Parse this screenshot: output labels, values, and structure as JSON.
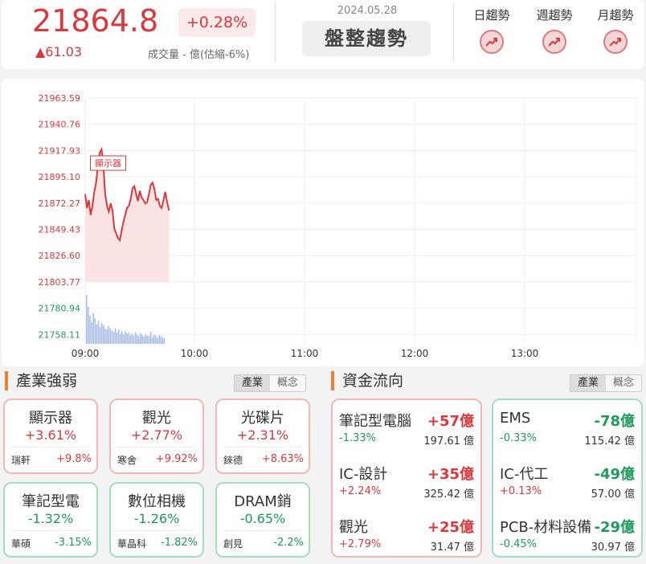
{
  "header": {
    "price": "21864.8",
    "pct": "+0.28%",
    "change": "▲61.03",
    "volume": "成交量 - 億(估縮-6%)",
    "date": "2024.05.28",
    "trend": "盤整趨勢",
    "trend_items": [
      "日趨勢",
      "週趨勢",
      "月趨勢"
    ]
  },
  "chart_data": {
    "type": "line",
    "x_ticks": [
      "09:00",
      "10:00",
      "11:00",
      "12:00",
      "13:00"
    ],
    "y_ticks": [
      "21963.59",
      "21940.76",
      "21917.93",
      "21895.10",
      "21872.27",
      "21849.43",
      "21826.60",
      "21803.77",
      "21780.94",
      "21758.11"
    ],
    "ylim": [
      21745,
      21970
    ],
    "xlim": [
      0,
      300
    ],
    "annotation": {
      "x": 2,
      "text": "顯示器"
    },
    "price": [
      [
        0,
        21880
      ],
      [
        1,
        21868
      ],
      [
        2,
        21875
      ],
      [
        3,
        21862
      ],
      [
        4,
        21870
      ],
      [
        5,
        21882
      ],
      [
        6,
        21890
      ],
      [
        7,
        21905
      ],
      [
        8,
        21916
      ],
      [
        9,
        21919
      ],
      [
        10,
        21905
      ],
      [
        11,
        21880
      ],
      [
        12,
        21870
      ],
      [
        13,
        21865
      ],
      [
        14,
        21872
      ],
      [
        15,
        21866
      ],
      [
        16,
        21850
      ],
      [
        17,
        21846
      ],
      [
        18,
        21842
      ],
      [
        19,
        21840
      ],
      [
        20,
        21848
      ],
      [
        21,
        21856
      ],
      [
        22,
        21862
      ],
      [
        23,
        21868
      ],
      [
        24,
        21870
      ],
      [
        25,
        21876
      ],
      [
        26,
        21885
      ],
      [
        27,
        21887
      ],
      [
        28,
        21880
      ],
      [
        29,
        21874
      ],
      [
        30,
        21883
      ],
      [
        31,
        21877
      ],
      [
        32,
        21875
      ],
      [
        33,
        21872
      ],
      [
        34,
        21873
      ],
      [
        35,
        21880
      ],
      [
        36,
        21888
      ],
      [
        37,
        21890
      ],
      [
        38,
        21885
      ],
      [
        39,
        21875
      ],
      [
        40,
        21876
      ],
      [
        41,
        21870
      ],
      [
        42,
        21868
      ],
      [
        43,
        21875
      ],
      [
        44,
        21882
      ],
      [
        45,
        21873
      ],
      [
        46,
        21866
      ]
    ],
    "volume_bars": [
      0.95,
      0.72,
      0.55,
      0.42,
      0.6,
      0.5,
      0.38,
      0.45,
      0.33,
      0.4,
      0.36,
      0.3,
      0.28,
      0.35,
      0.3,
      0.26,
      0.24,
      0.3,
      0.22,
      0.28,
      0.2,
      0.25,
      0.18,
      0.24,
      0.2,
      0.22,
      0.17,
      0.2,
      0.16,
      0.23,
      0.18,
      0.15,
      0.21,
      0.17,
      0.14,
      0.19,
      0.16,
      0.15,
      0.24,
      0.13,
      0.18,
      0.16,
      0.12,
      0.17,
      0.15,
      0.13,
      0.11
    ]
  },
  "sections": {
    "industry_title": "產業強弱",
    "flow_title": "資金流向",
    "seg_a": "產業",
    "seg_b": "概念"
  },
  "cards": [
    {
      "name": "顯示器",
      "pct": "+3.61%",
      "stock": "瑞軒",
      "stock_pct": "+9.8%",
      "dir": "up"
    },
    {
      "name": "觀光",
      "pct": "+2.77%",
      "stock": "寒舍",
      "stock_pct": "+9.92%",
      "dir": "up"
    },
    {
      "name": "光碟片",
      "pct": "+2.31%",
      "stock": "錸德",
      "stock_pct": "+8.63%",
      "dir": "up"
    },
    {
      "name": "筆記型電",
      "pct": "-1.32%",
      "stock": "華碩",
      "stock_pct": "-3.15%",
      "dir": "dn"
    },
    {
      "name": "數位相機",
      "pct": "-1.26%",
      "stock": "華晶科",
      "stock_pct": "-1.82%",
      "dir": "dn"
    },
    {
      "name": "DRAM銷",
      "pct": "-0.65%",
      "stock": "創見",
      "stock_pct": "-2.2%",
      "dir": "dn"
    }
  ],
  "flows_up": [
    {
      "name": "筆記型電腦",
      "amount": "+57億",
      "pct": "-1.33%",
      "value": "197.61 億",
      "pdir": "dn"
    },
    {
      "name": "IC-設計",
      "amount": "+35億",
      "pct": "+2.24%",
      "value": "325.42 億",
      "pdir": "up"
    },
    {
      "name": "觀光",
      "amount": "+25億",
      "pct": "+2.79%",
      "value": "31.47 億",
      "pdir": "up"
    }
  ],
  "flows_dn": [
    {
      "name": "EMS",
      "amount": "-78億",
      "pct": "-0.33%",
      "value": "115.42 億",
      "pdir": "dn"
    },
    {
      "name": "IC-代工",
      "amount": "-49億",
      "pct": "+0.13%",
      "value": "57.00 億",
      "pdir": "up"
    },
    {
      "name": "PCB-材料設備",
      "amount": "-29億",
      "pct": "-0.45%",
      "value": "30.97 億",
      "pdir": "dn"
    }
  ]
}
